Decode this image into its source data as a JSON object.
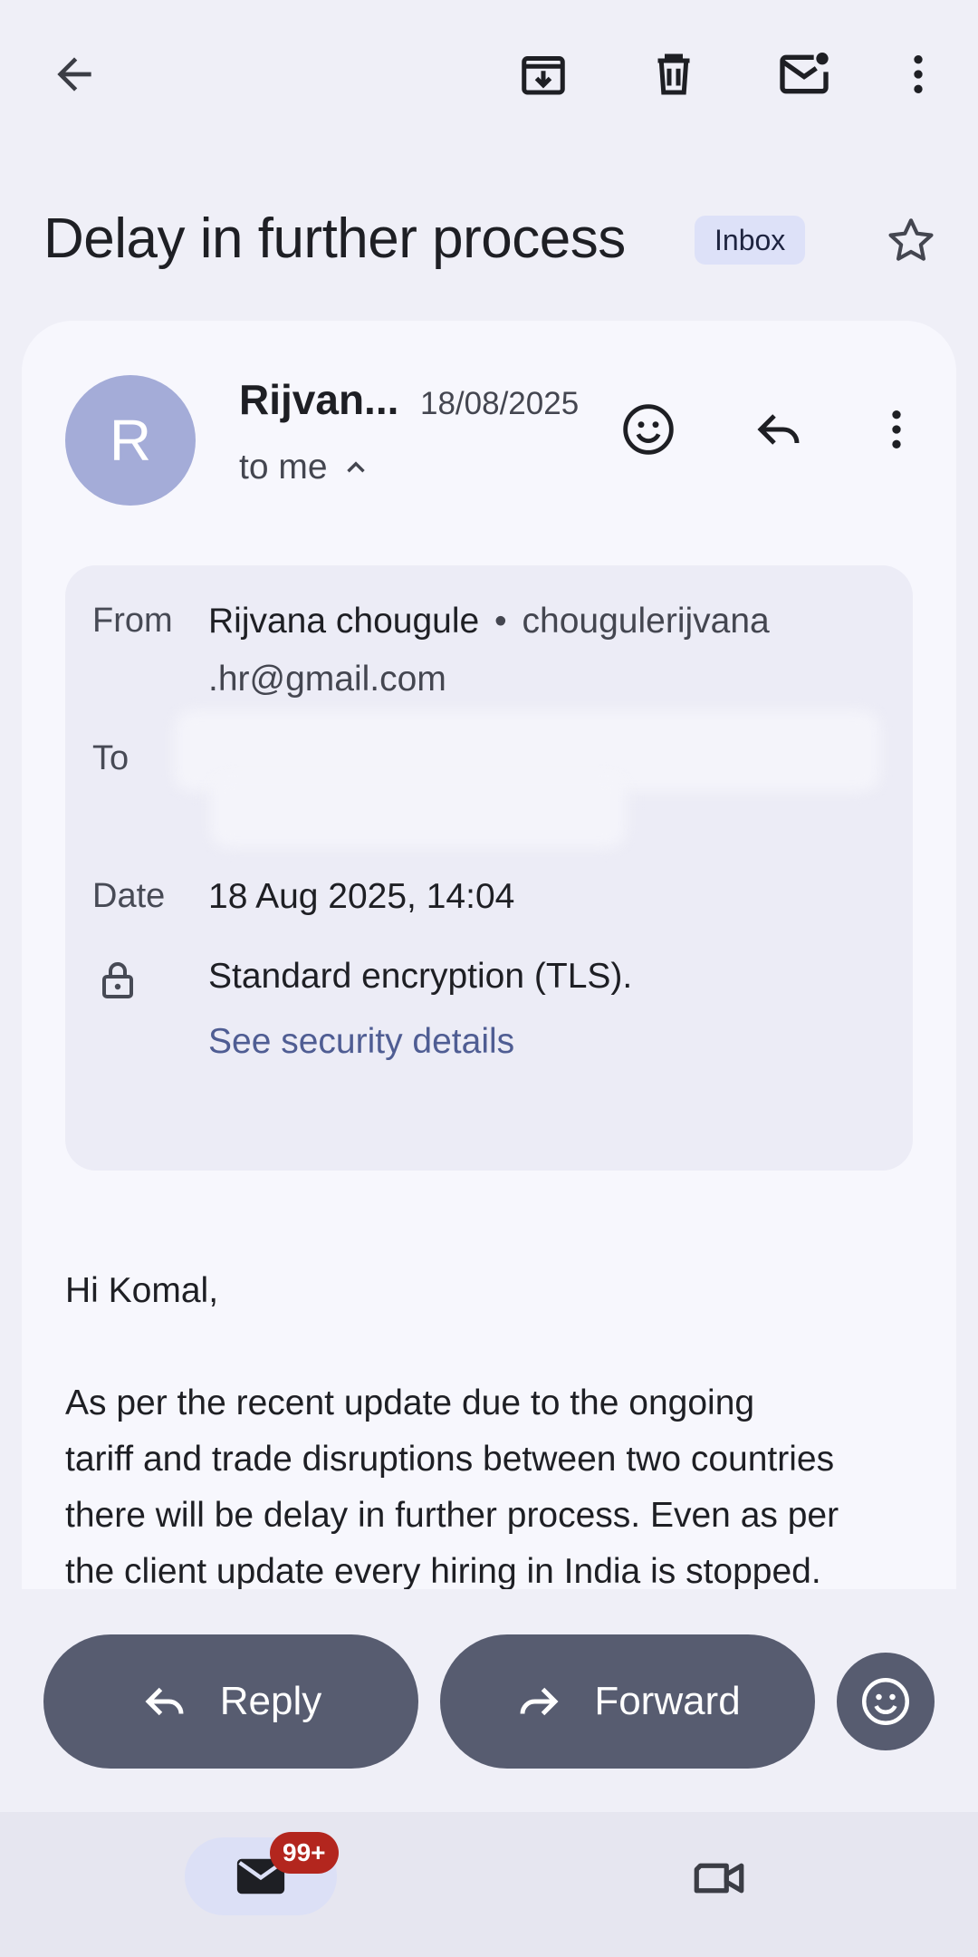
{
  "subject": "Delay in further process",
  "label": "Inbox",
  "sender": {
    "initial": "R",
    "name_short": "Rijvan...",
    "date_short": "18/08/2025",
    "to_me": "to me"
  },
  "details": {
    "from_label": "From",
    "from_name": "Rijvana chougule",
    "from_sep": "•",
    "from_email_line1": "chougulerijvana",
    "from_email_line2": ".hr@gmail.com",
    "to_label": "To",
    "date_label": "Date",
    "date_value": "18 Aug 2025, 14:04",
    "encryption": "Standard encryption (TLS).",
    "security_link": "See security details"
  },
  "body": {
    "greeting": "Hi Komal,",
    "lines": [
      "As per the recent update due to the ongoing",
      "tariff and trade disruptions between two countries",
      "there will be delay in further process. Even as per",
      "the client update every hiring in India is stopped."
    ]
  },
  "actions": {
    "reply": "Reply",
    "forward": "Forward"
  },
  "bottom_nav": {
    "mail_badge": "99+"
  },
  "colors": {
    "background": "#efeff7",
    "card": "#f7f7fd",
    "avatar": "#a4acd8",
    "action_button": "#575c70",
    "link": "#4f5d93",
    "badge": "#b3261e"
  }
}
